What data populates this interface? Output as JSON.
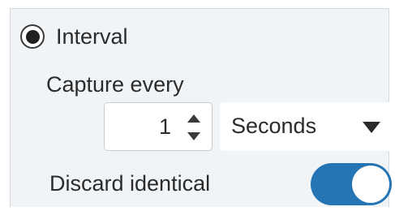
{
  "interval": {
    "label": "Interval",
    "selected": true
  },
  "capture": {
    "label": "Capture every",
    "value": "1",
    "unit": "Seconds"
  },
  "discard": {
    "label": "Discard identical",
    "enabled": true
  },
  "colors": {
    "panel_bg": "#f1f4f7",
    "toggle_on": "#2575b5",
    "text": "#2b2b2b"
  },
  "icons": {
    "stepper_up": "caret-up-icon",
    "stepper_down": "caret-down-icon",
    "dropdown": "chevron-down-icon"
  }
}
